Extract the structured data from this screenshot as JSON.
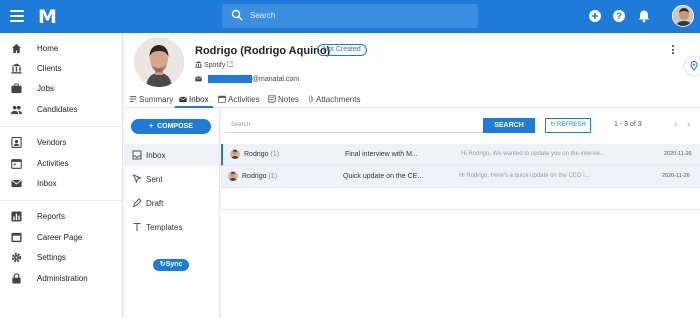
{
  "app": {
    "logo": "M"
  },
  "topbar": {
    "search_placeholder": "Search"
  },
  "sidebar": {
    "items": [
      {
        "label": "Home",
        "icon": "home-icon"
      },
      {
        "label": "Clients",
        "icon": "bank-icon"
      },
      {
        "label": "Jobs",
        "icon": "briefcase-icon"
      },
      {
        "label": "Candidates",
        "icon": "people-icon"
      },
      {
        "label": "Vendors",
        "icon": "contact-card-icon"
      },
      {
        "label": "Activities",
        "icon": "calendar-icon"
      },
      {
        "label": "Inbox",
        "icon": "mail-icon"
      },
      {
        "label": "Reports",
        "icon": "bar-chart-icon"
      },
      {
        "label": "Career Page",
        "icon": "web-page-icon"
      },
      {
        "label": "Settings",
        "icon": "gear-icon"
      },
      {
        "label": "Administration",
        "icon": "lock-icon"
      }
    ]
  },
  "profile": {
    "name": "Rodrigo (Rodrigo Aquino)",
    "status_badge": "Not Created",
    "company": "Spotify",
    "email_domain": "@manatal.com"
  },
  "tabs": [
    {
      "label": "Summary"
    },
    {
      "label": "Inbox"
    },
    {
      "label": "Activities"
    },
    {
      "label": "Notes"
    },
    {
      "label": "Attachments"
    }
  ],
  "mail": {
    "compose_label": "COMPOSE",
    "folders": [
      {
        "label": "Inbox"
      },
      {
        "label": "Sent"
      },
      {
        "label": "Draft"
      },
      {
        "label": "Templates"
      }
    ],
    "sync_label": "Sync",
    "search_placeholder": "Search",
    "search_button": "SEARCH",
    "refresh_button": "REFRESH",
    "pagination": "1 - 3 of 3",
    "messages": [
      {
        "from": "Rodrigo",
        "count": "(1)",
        "subject": "Final interview with M...",
        "preview": "Hi Rodrigo, We wanted to update you on the intervie...",
        "date": "2020-11-26"
      },
      {
        "from": "Rodrigo",
        "count": "(1)",
        "subject": "Quick update on the CE...",
        "preview": "Hi Rodrigo,  Here's a quick update on the CEO i...",
        "date": "2020-11-26"
      }
    ]
  },
  "colors": {
    "primary": "#1e7bd8",
    "topbar": "#1e7bd8"
  }
}
